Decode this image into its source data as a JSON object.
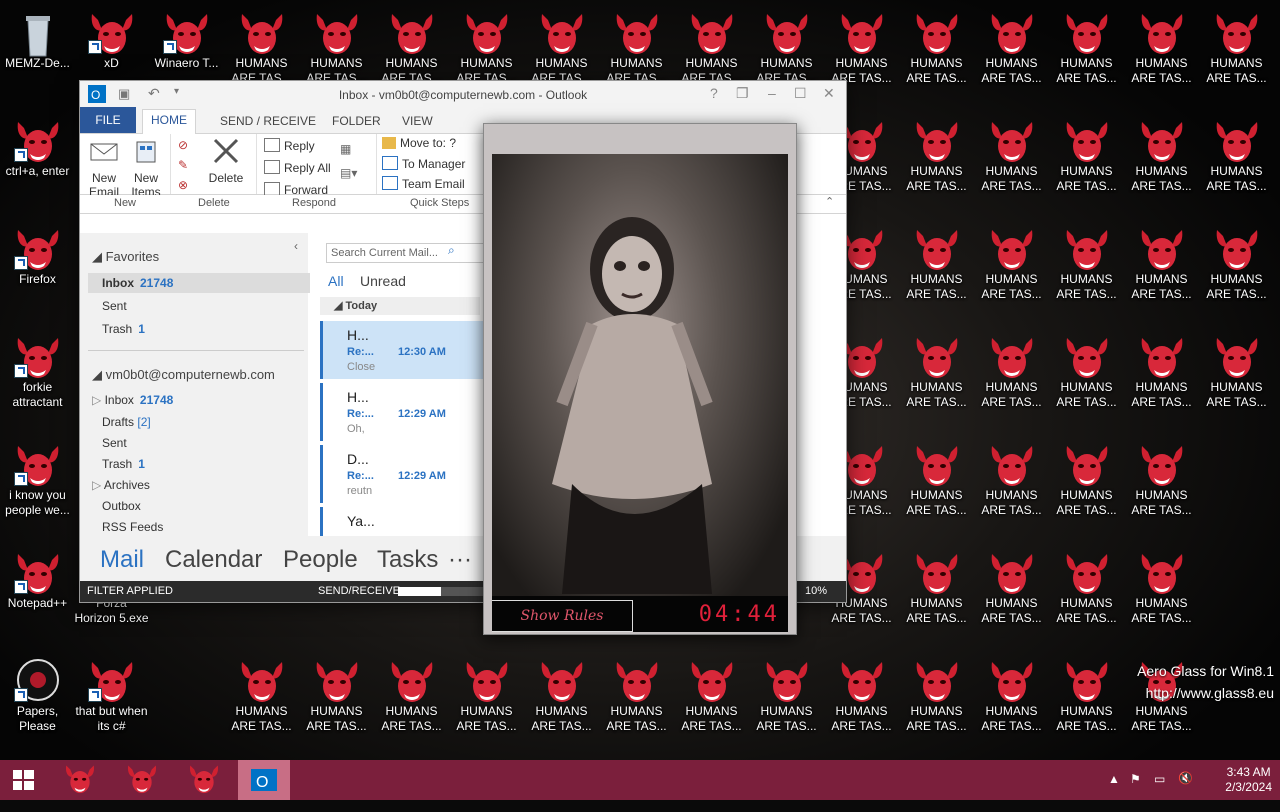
{
  "desktop": {
    "icons": [
      {
        "label": "MEMZ-De...",
        "kind": "recycle"
      },
      {
        "label": "xD",
        "kind": "demon"
      },
      {
        "label": "Winaero T...",
        "kind": "demon"
      },
      {
        "label": "ctrl+a, enter",
        "kind": "demon"
      },
      {
        "label": "Firefox",
        "kind": "demon"
      },
      {
        "label": "forkie attractant",
        "kind": "demon"
      },
      {
        "label": "i know you people we...",
        "kind": "demon"
      },
      {
        "label": "Notepad++",
        "kind": "demon"
      },
      {
        "label": "Papers, Please",
        "kind": "papers"
      },
      {
        "label": "that but when its c#",
        "kind": "demon"
      },
      {
        "label": "Forza Horizon 5.exe",
        "kind": "none"
      }
    ],
    "repeat_label": "HUMANS ARE TAS...",
    "watermark_line1": "Aero Glass for Win8.1",
    "watermark_line2": "http://www.glass8.eu"
  },
  "outlook": {
    "title": "Inbox - vm0b0t@computernewb.com - Outlook",
    "title_controls": [
      "?",
      "❐",
      "–",
      "☐",
      "✕"
    ],
    "tabs": [
      "FILE",
      "HOME",
      "SEND / RECEIVE",
      "FOLDER",
      "VIEW"
    ],
    "ribbon": {
      "new_email": "New Email",
      "new_items": "New Items",
      "delete": "Delete",
      "reply": "Reply",
      "reply_all": "Reply All",
      "forward": "Forward",
      "move_to": "Move to: ?",
      "to_manager": "To Manager",
      "team_email": "Team Email",
      "groups": [
        "New",
        "Delete",
        "Respond",
        "Quick Steps"
      ]
    },
    "folders": {
      "favorites": "Favorites",
      "fav_inbox": "Inbox",
      "fav_inbox_count": "21748",
      "fav_sent": "Sent",
      "fav_trash": "Trash",
      "fav_trash_count": "1",
      "account": "vm0b0t@computernewb.com",
      "inbox": "Inbox",
      "inbox_count": "21748",
      "drafts": "Drafts",
      "drafts_count": "[2]",
      "sent": "Sent",
      "trash": "Trash",
      "trash_count": "1",
      "archives": "Archives",
      "outbox": "Outbox",
      "rss": "RSS Feeds"
    },
    "list": {
      "search_placeholder": "Search Current Mail...",
      "all": "All",
      "unread": "Unread",
      "today": "Today",
      "messages": [
        {
          "from": "H...",
          "subj": "Re:...",
          "time": "12:30 AM",
          "prev": "Close"
        },
        {
          "from": "H...",
          "subj": "Re:...",
          "time": "12:29 AM",
          "prev": "Oh,"
        },
        {
          "from": "D...",
          "subj": "Re:...",
          "time": "12:29 AM",
          "prev": "reutn"
        },
        {
          "from": "Ya...",
          "subj": "",
          "time": "",
          "prev": ""
        }
      ]
    },
    "nav": [
      "Mail",
      "Calendar",
      "People",
      "Tasks",
      "···"
    ],
    "status": {
      "filter": "FILTER APPLIED",
      "send_receive": "SEND/RECEIVE",
      "zoom": "10%"
    }
  },
  "scary": {
    "rules_label": "Show Rules",
    "timer": "04:44"
  },
  "taskbar": {
    "time": "3:43 AM",
    "date": "2/3/2024"
  }
}
